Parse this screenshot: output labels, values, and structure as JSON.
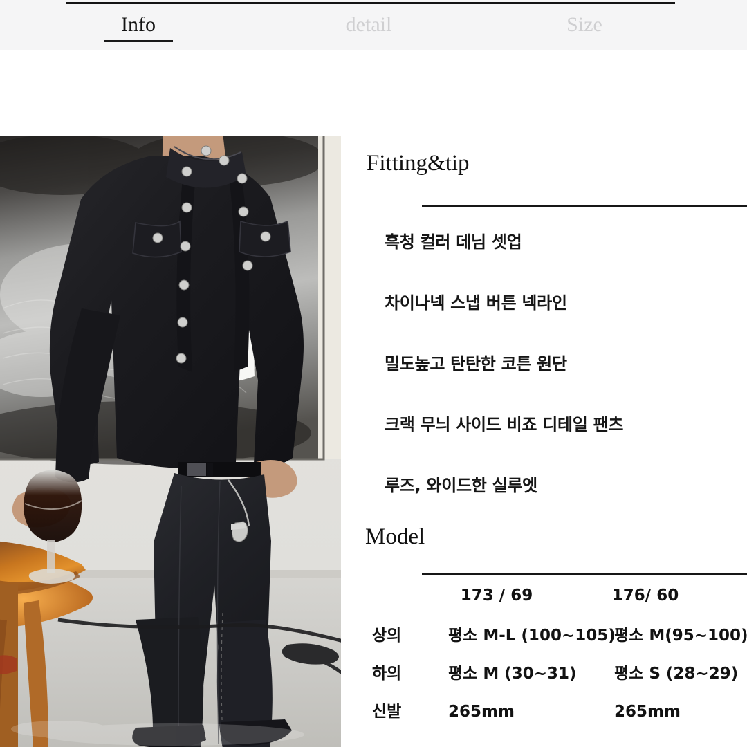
{
  "tabs": [
    {
      "label": "Info",
      "active": true
    },
    {
      "label": "detail",
      "active": false
    },
    {
      "label": "Size",
      "active": false
    }
  ],
  "photo": {
    "alt": "model-wearing-black-denim-jacket-and-wide-black-jeans",
    "scene": "Model standing indoors holding a stemmed glass of dark drink, wooden side table at left, abstract grey-black painting backdrop, light grey floor"
  },
  "fitting": {
    "heading": "Fitting&tip",
    "items": [
      "흑청 컬러 데님 셋업",
      "차이나넥 스냅 버튼 넥라인",
      "밀도높고 탄탄한 코튼 원단",
      "크랙 무늬 사이드 비죠 디테일 팬츠",
      "루즈, 와이드한 실루엣"
    ]
  },
  "model": {
    "heading": "Model",
    "columns": [
      "173 / 69",
      "176/ 60"
    ],
    "rows": [
      {
        "label": "상의",
        "values": [
          "평소 M-L (100~105)",
          "평소 M(95~100)"
        ]
      },
      {
        "label": "하의",
        "values": [
          "평소 M (30~31)",
          "평소 S (28~29)"
        ]
      },
      {
        "label": "신발",
        "values": [
          "265mm",
          "265mm"
        ]
      }
    ]
  },
  "colors": {
    "tabbar_bg": "#f5f5f6",
    "active_tab": "#121212",
    "inactive_tab": "#cfcfd1",
    "rule": "#171717",
    "text": "#121212",
    "page_bg": "#ffffff"
  }
}
